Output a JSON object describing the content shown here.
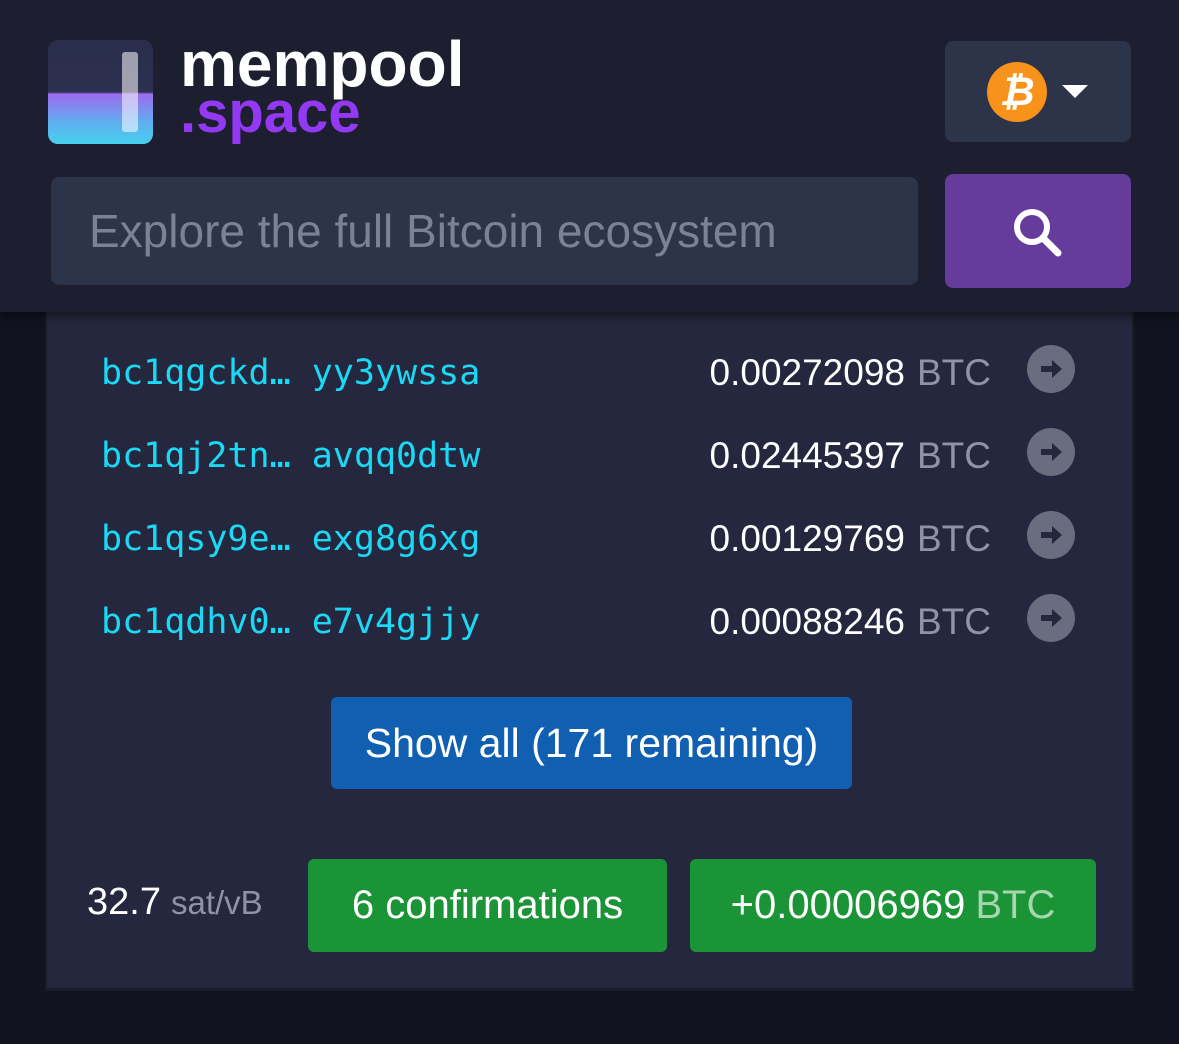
{
  "header": {
    "logo_line1": "mempool",
    "logo_line2": ".space",
    "network_icon": "bitcoin-icon",
    "network_symbol": "₿",
    "search_placeholder": "Explore the full Bitcoin ecosystem",
    "accent_color": "#9339f4"
  },
  "outputs": [
    {
      "address_start": "bc1qgckd…",
      "address_end": "yy3ywssa",
      "amount": "0.00272098",
      "unit": "BTC"
    },
    {
      "address_start": "bc1qj2tn…",
      "address_end": "avqq0dtw",
      "amount": "0.02445397",
      "unit": "BTC"
    },
    {
      "address_start": "bc1qsy9e…",
      "address_end": "exg8g6xg",
      "amount": "0.00129769",
      "unit": "BTC"
    },
    {
      "address_start": "bc1qdhv0…",
      "address_end": "e7v4gjjy",
      "amount": "0.00088246",
      "unit": "BTC"
    }
  ],
  "show_all_label": "Show all (171 remaining)",
  "footer": {
    "fee_value": "32.7",
    "fee_unit": "sat/vB",
    "confirmations_label": "6 confirmations",
    "delta_value": "+0.00006969",
    "delta_unit": "BTC",
    "badge_color": "#1a9436"
  }
}
